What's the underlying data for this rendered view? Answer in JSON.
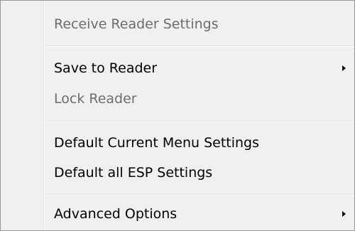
{
  "menu": {
    "items": [
      {
        "label": "Receive Reader Settings",
        "enabled": false
      },
      {
        "label": "Save to Reader",
        "enabled": true,
        "submenu_icon": "chevron-right-icon"
      },
      {
        "label": "Lock Reader",
        "enabled": false
      },
      {
        "label": "Default Current Menu Settings",
        "enabled": true
      },
      {
        "label": "Default all ESP Settings",
        "enabled": true
      },
      {
        "label": "Advanced Options",
        "enabled": true,
        "submenu_icon": "chevron-right-icon"
      }
    ]
  },
  "colors": {
    "background": "#f0f0f0",
    "border": "#979797",
    "disabled_text": "#6d6d6d",
    "separator": "#e0e0e0"
  }
}
